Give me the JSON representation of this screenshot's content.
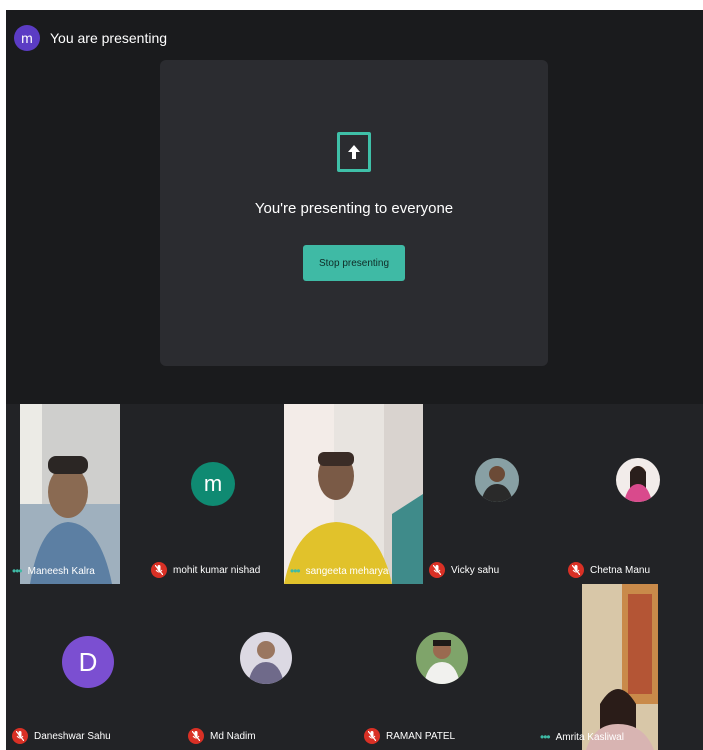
{
  "header": {
    "avatar_letter": "m",
    "title": "You are presenting"
  },
  "presenting": {
    "message": "You're presenting to everyone",
    "stop_button": "Stop presenting"
  },
  "participants": [
    {
      "name": "Maneesh Kalra",
      "status": "speaking"
    },
    {
      "name": "mohit kumar nishad",
      "status": "muted",
      "avatar_letter": "m"
    },
    {
      "name": "sangeeta meharya",
      "status": "speaking"
    },
    {
      "name": "Vicky sahu",
      "status": "muted"
    },
    {
      "name": "Chetna Manu",
      "status": "muted"
    },
    {
      "name": "Daneshwar Sahu",
      "status": "muted",
      "avatar_letter": "D"
    },
    {
      "name": "Md Nadim",
      "status": "muted"
    },
    {
      "name": "RAMAN PATEL",
      "status": "muted"
    },
    {
      "name": "Amrita Kasliwal",
      "status": "speaking"
    }
  ],
  "colors": {
    "background": "#1a1b1d",
    "card": "#2b2c30",
    "accent": "#3fbaa5",
    "mute": "#d93025",
    "header_avatar": "#5b3cc4",
    "avatar_green": "#0f8a72",
    "avatar_purple": "#7b4fd1"
  }
}
